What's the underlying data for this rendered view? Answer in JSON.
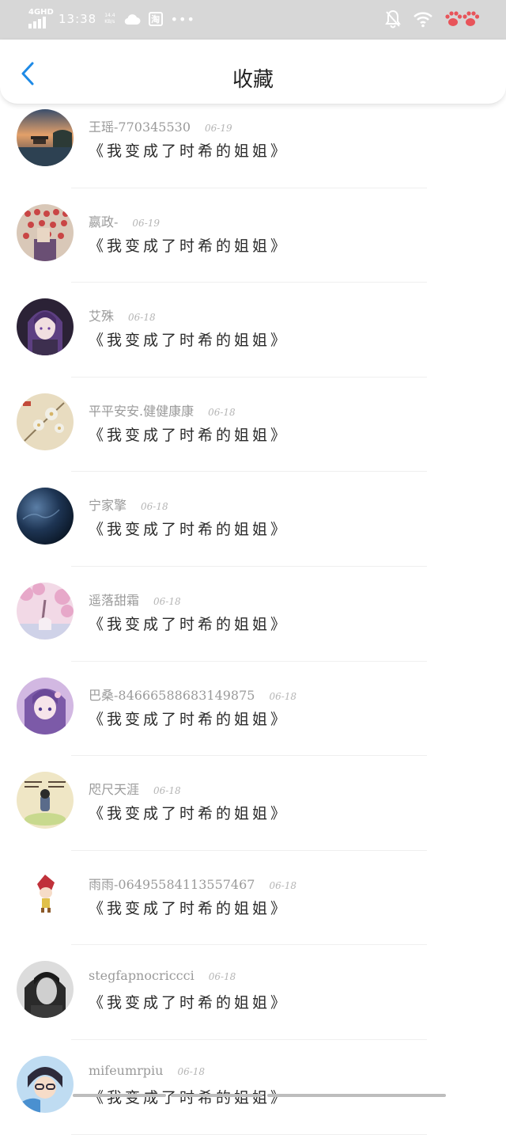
{
  "status_bar": {
    "network": "4GHD",
    "time": "13:38",
    "speed_value": "14.4",
    "speed_unit": "KB/s",
    "taobao_label": "淘",
    "more_dots": "•••",
    "icons": [
      "signal-icon",
      "cloud-icon",
      "taobao-icon",
      "mute-bell-icon",
      "wifi-icon",
      "paw-icon"
    ],
    "colors": {
      "background": "#d7d7d7",
      "paw": "#e8545a"
    }
  },
  "header": {
    "title": "收藏",
    "back_icon": "chevron-left-icon",
    "accent": "#1e8ae6"
  },
  "items": [
    {
      "name": "王瑶-770345530",
      "date": "06-19",
      "book": "《我变成了时希的姐姐》",
      "avatar_icon": "avatar-sunset-pavilion"
    },
    {
      "name": "嬴政-",
      "date": "06-19",
      "book": "《我变成了时希的姐姐》",
      "avatar_icon": "avatar-red-lanterns"
    },
    {
      "name": "艾殊",
      "date": "06-18",
      "book": "《我变成了时希的姐姐》",
      "avatar_icon": "avatar-purple-hair-girl"
    },
    {
      "name": "平平安安.健健康康",
      "date": "06-18",
      "book": "《我变成了时希的姐姐》",
      "avatar_icon": "avatar-flower-painting"
    },
    {
      "name": "宁家擎",
      "date": "06-18",
      "book": "《我变成了时希的姐姐》",
      "avatar_icon": "avatar-dark-planet"
    },
    {
      "name": "遥落甜霜",
      "date": "06-18",
      "book": "《我变成了时希的姐姐》",
      "avatar_icon": "avatar-pink-blossom"
    },
    {
      "name": "巴桑-84666588683149875",
      "date": "06-18",
      "book": "《我变成了时希的姐姐》",
      "avatar_icon": "avatar-anime-princess"
    },
    {
      "name": "咫尺天涯",
      "date": "06-18",
      "book": "《我变成了时希的姐姐》",
      "avatar_icon": "avatar-cartoon-note"
    },
    {
      "name": "雨雨-06495584113557467",
      "date": "06-18",
      "book": "《我变成了时希的姐姐》",
      "avatar_icon": "avatar-small-character"
    },
    {
      "name": "stegfapnocriccci",
      "date": "06-18",
      "book": "《我变成了时希的姐姐》",
      "avatar_icon": "avatar-bw-portrait"
    },
    {
      "name": "mifeumrpiu",
      "date": "06-18",
      "book": "《我变成了时希的姐姐》",
      "avatar_icon": "avatar-anime-boy"
    }
  ]
}
